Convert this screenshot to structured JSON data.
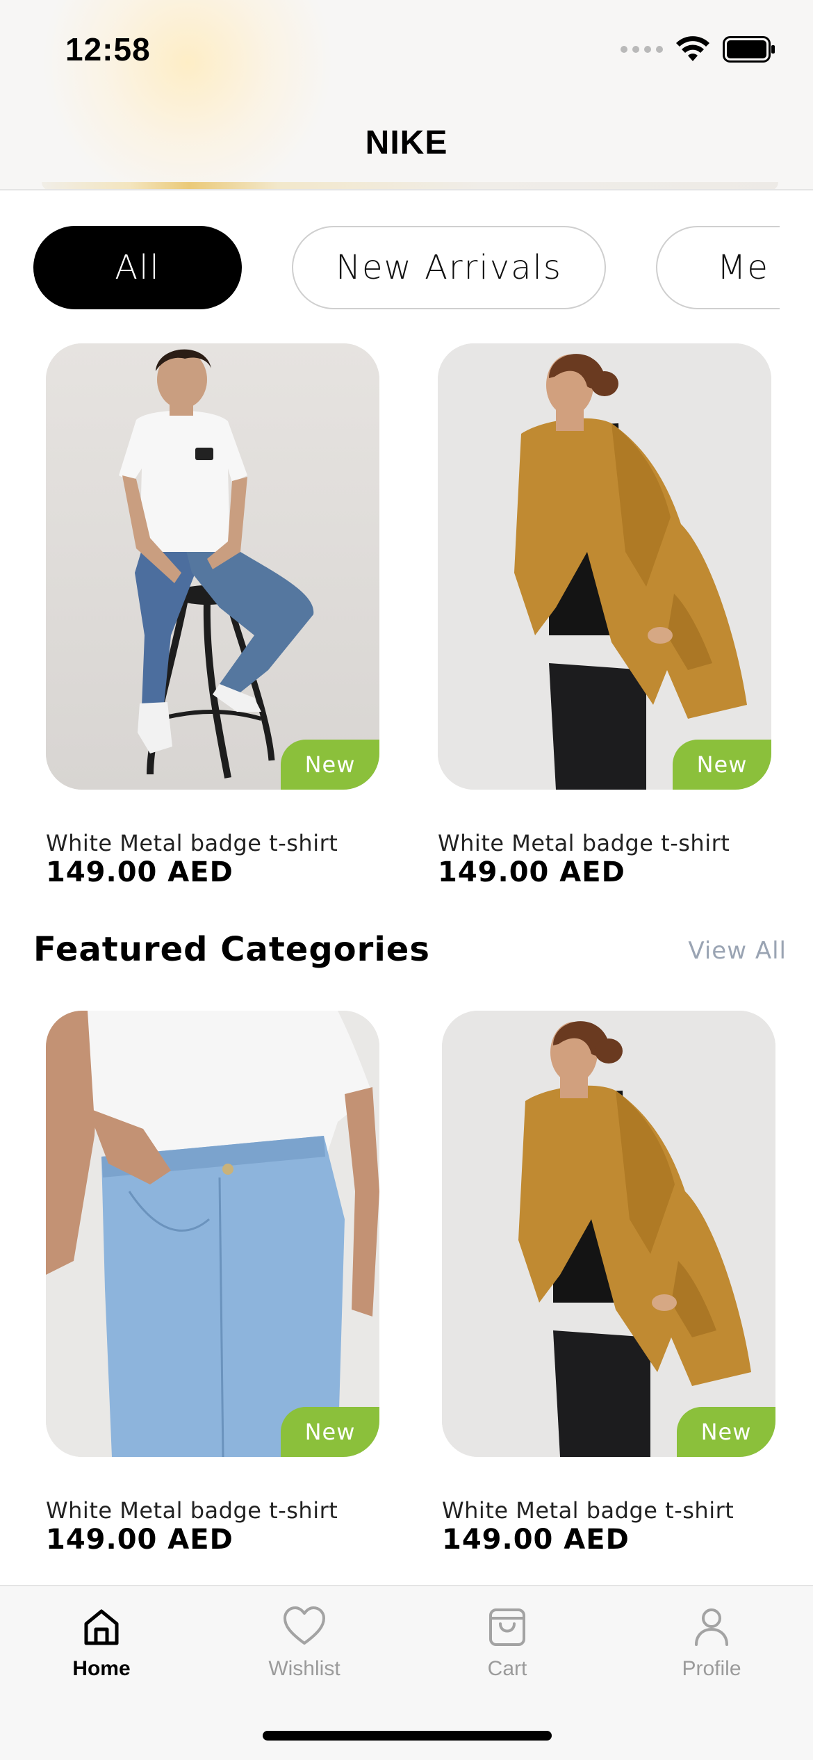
{
  "status_bar": {
    "time": "12:58"
  },
  "header": {
    "title": "NIKE"
  },
  "filters": [
    {
      "label": "All",
      "active": true
    },
    {
      "label": "New Arrivals",
      "active": false
    },
    {
      "label": "Me",
      "active": false
    }
  ],
  "products_top": [
    {
      "name": "White Metal badge t-shirt",
      "price": "149.00 AED",
      "badge": "New",
      "image": "man-white-tshirt-jeans-on-stool"
    },
    {
      "name": "White Metal badge t-shirt",
      "price": "149.00 AED",
      "badge": "New",
      "image": "woman-tan-leather-jacket"
    }
  ],
  "featured": {
    "title": "Featured Categories",
    "view_all": "View All"
  },
  "products_featured": [
    {
      "name": "White Metal badge t-shirt",
      "price": "149.00 AED",
      "badge": "New",
      "image": "light-blue-jeans-closeup"
    },
    {
      "name": "White Metal badge t-shirt",
      "price": "149.00 AED",
      "badge": "New",
      "image": "woman-tan-leather-jacket"
    }
  ],
  "nav": [
    {
      "label": "Home",
      "icon": "home-icon",
      "active": true
    },
    {
      "label": "Wishlist",
      "icon": "heart-icon",
      "active": false
    },
    {
      "label": "Cart",
      "icon": "bag-icon",
      "active": false
    },
    {
      "label": "Profile",
      "icon": "person-icon",
      "active": false
    }
  ],
  "colors": {
    "accent_badge": "#8bc03b",
    "active_chip": "#000000",
    "view_all": "#9aa4b3"
  }
}
